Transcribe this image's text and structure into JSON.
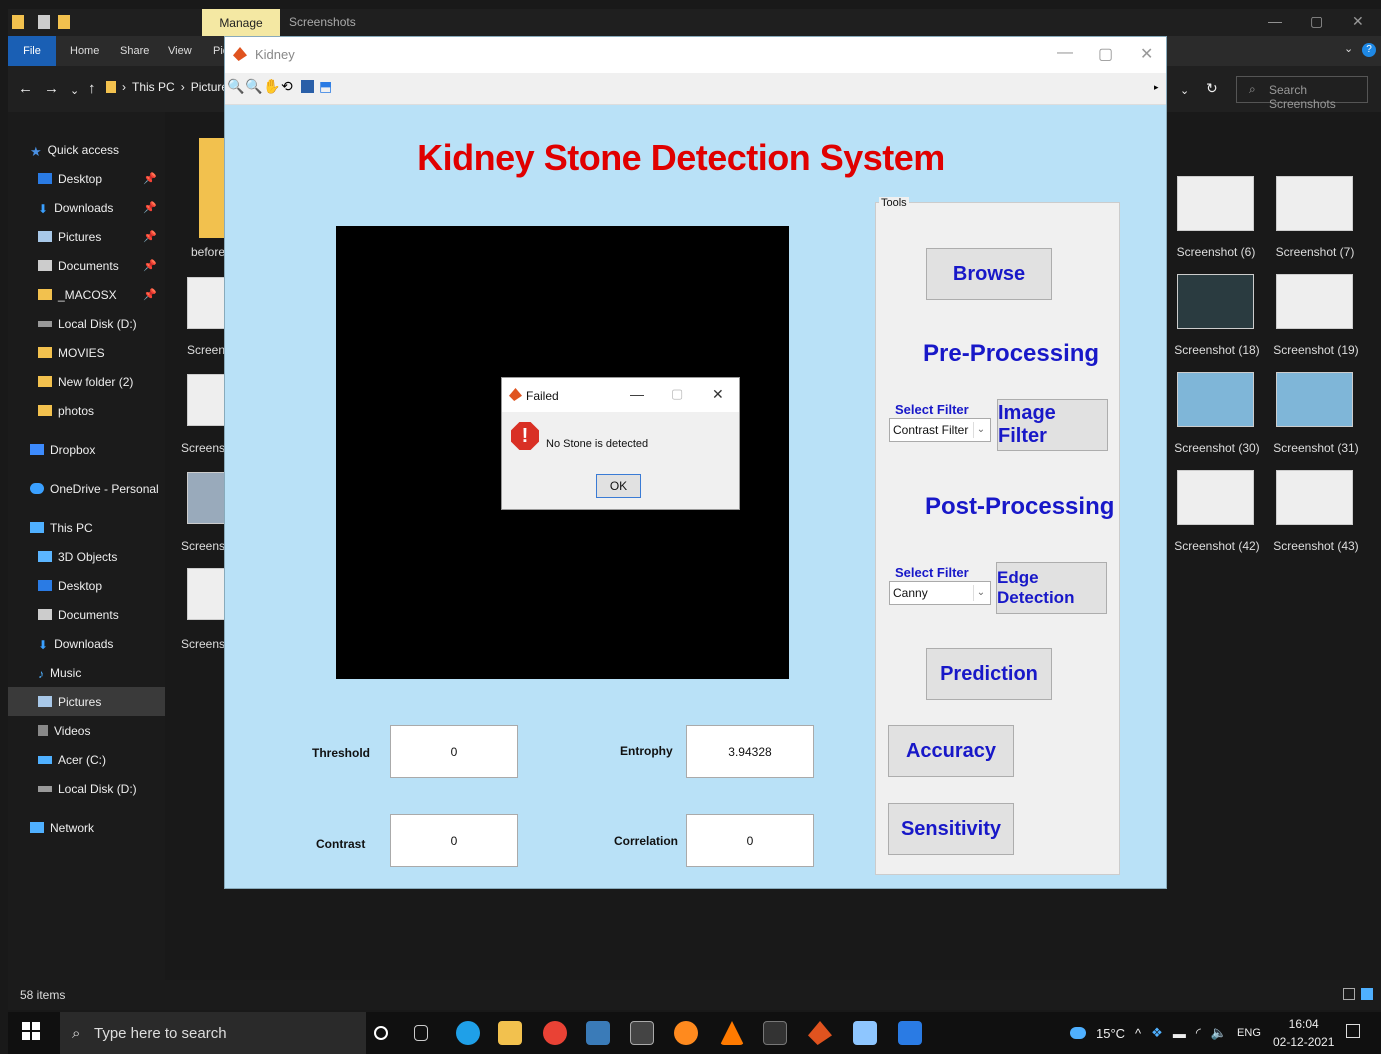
{
  "explorer": {
    "manage_tab": "Manage",
    "window_title": "Screenshots",
    "ribbon_tabs": [
      "File",
      "Home",
      "Share",
      "View",
      "Pic"
    ],
    "breadcrumb": [
      "This PC",
      "Pictures"
    ],
    "search_placeholder": "Search Screenshots",
    "status": "58 items"
  },
  "sidebar": {
    "items": [
      {
        "label": "Quick access",
        "icon": "star-icon"
      },
      {
        "label": "Desktop",
        "icon": "desktop-icon"
      },
      {
        "label": "Downloads",
        "icon": "download-icon"
      },
      {
        "label": "Pictures",
        "icon": "pictures-icon"
      },
      {
        "label": "Documents",
        "icon": "documents-icon"
      },
      {
        "label": "_MACOSX",
        "icon": "folder-icon"
      },
      {
        "label": "Local Disk (D:)",
        "icon": "drive-icon"
      },
      {
        "label": "MOVIES",
        "icon": "folder-icon"
      },
      {
        "label": "New folder (2)",
        "icon": "folder-icon"
      },
      {
        "label": "photos",
        "icon": "folder-icon"
      },
      {
        "label": "Dropbox",
        "icon": "dropbox-icon"
      },
      {
        "label": "OneDrive - Personal",
        "icon": "cloud-icon"
      },
      {
        "label": "This PC",
        "icon": "pc-icon"
      },
      {
        "label": "3D Objects",
        "icon": "cube-icon"
      },
      {
        "label": "Desktop",
        "icon": "desktop-icon"
      },
      {
        "label": "Documents",
        "icon": "documents-icon"
      },
      {
        "label": "Downloads",
        "icon": "download-icon"
      },
      {
        "label": "Music",
        "icon": "music-icon"
      },
      {
        "label": "Pictures",
        "icon": "pictures-icon"
      },
      {
        "label": "Videos",
        "icon": "video-icon"
      },
      {
        "label": "Acer (C:)",
        "icon": "drive-icon"
      },
      {
        "label": "Local Disk (D:)",
        "icon": "drive-icon"
      },
      {
        "label": "Network",
        "icon": "network-icon"
      }
    ]
  },
  "files": {
    "left_partial": [
      "before",
      "Screen",
      "Screens",
      "Screens",
      "Screens"
    ],
    "right": [
      "Screenshot (6)",
      "Screenshot (7)",
      "Screenshot (18)",
      "Screenshot (19)",
      "Screenshot (30)",
      "Screenshot (31)",
      "Screenshot (42)",
      "Screenshot (43)"
    ]
  },
  "taskbar": {
    "search_placeholder": "Type here to search",
    "temperature": "15°C",
    "language": "ENG",
    "time": "16:04",
    "date": "02-12-2021"
  },
  "kidney": {
    "window_title": "Kidney",
    "app_title": "Kidney Stone Detection System",
    "tools_legend": "Tools",
    "browse": "Browse",
    "pre_processing": "Pre-Processing",
    "select_filter": "Select Filter",
    "image_filter_value": "Contrast Filter",
    "image_filter_button": "Image Filter",
    "post_processing": "Post-Processing",
    "edge_filter_value": "Canny",
    "edge_detection_button": "Edge Detection",
    "prediction": "Prediction",
    "accuracy": "Accuracy",
    "sensitivity": "Sensitivity",
    "metrics": {
      "threshold_label": "Threshold",
      "threshold_value": "0",
      "entropy_label": "Entrophy",
      "entropy_value": "3.94328",
      "contrast_label": "Contrast",
      "contrast_value": "0",
      "correlation_label": "Correlation",
      "correlation_value": "0"
    }
  },
  "dialog": {
    "title": "Failed",
    "message": "No Stone is detected",
    "ok": "OK"
  }
}
